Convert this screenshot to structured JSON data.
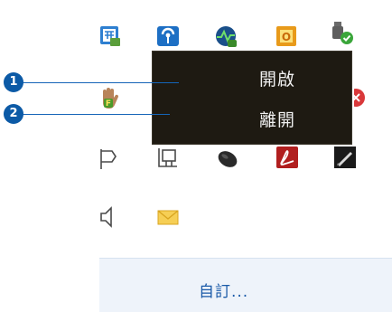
{
  "context_menu": {
    "items": [
      {
        "label": "開啟"
      },
      {
        "label": "離開"
      }
    ]
  },
  "callouts": [
    {
      "number": "1"
    },
    {
      "number": "2"
    }
  ],
  "customize": {
    "label": "自訂..."
  },
  "tray_icons": [
    "ime-icon",
    "wireless-icon",
    "network-activity-icon",
    "office-icon",
    "usb-device-icon",
    "gesture-hand-icon",
    "error-icon",
    "flag-icon",
    "network-cable-icon",
    "mouse-icon",
    "pdf-icon",
    "pen-icon",
    "volume-icon",
    "mail-icon"
  ],
  "colors": {
    "menu_background": "#1e1a12",
    "callout": "#0c5aa6",
    "link": "#1a5aa8"
  }
}
